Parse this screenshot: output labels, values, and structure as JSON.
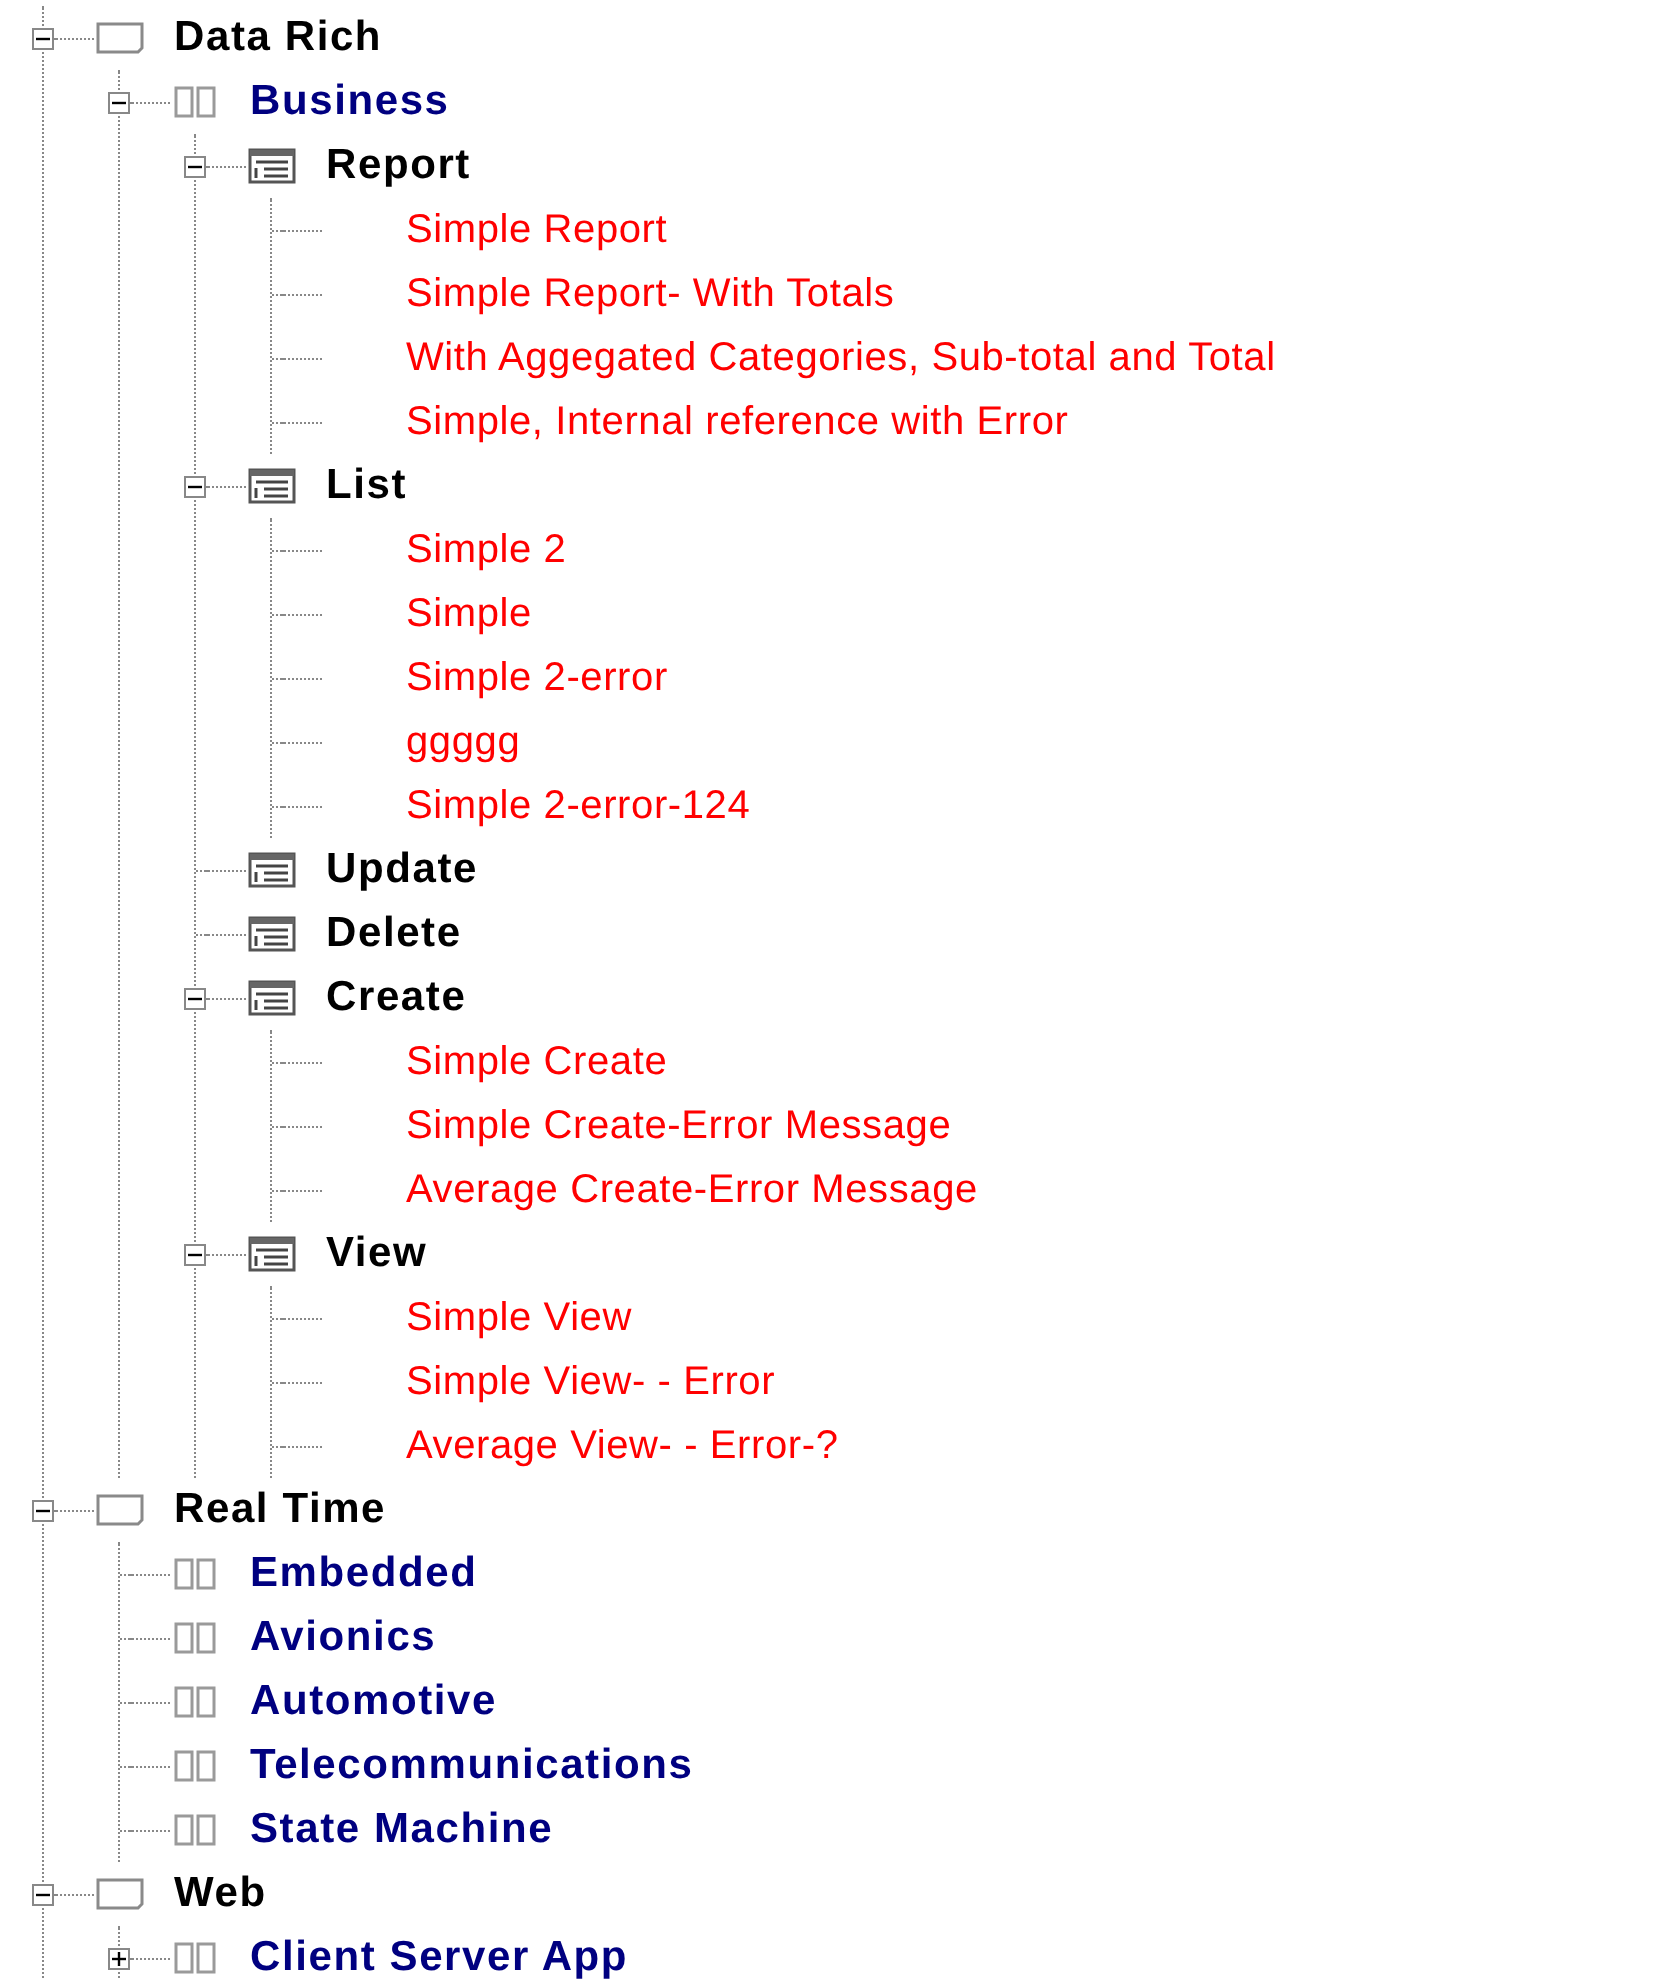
{
  "tree": {
    "nodes": [
      {
        "label": "Data Rich",
        "kind": "group",
        "expanded": true,
        "children": [
          {
            "label": "Business",
            "kind": "category",
            "expanded": true,
            "children": [
              {
                "label": "Report",
                "kind": "section",
                "expanded": true,
                "children": [
                  {
                    "label": "Simple Report",
                    "kind": "item"
                  },
                  {
                    "label": "Simple Report- With Totals",
                    "kind": "item"
                  },
                  {
                    "label": "With Aggegated Categories, Sub-total and Total",
                    "kind": "item"
                  },
                  {
                    "label": "Simple, Internal reference with Error",
                    "kind": "item"
                  }
                ]
              },
              {
                "label": "List",
                "kind": "section",
                "expanded": true,
                "children": [
                  {
                    "label": "Simple 2",
                    "kind": "item"
                  },
                  {
                    "label": "Simple",
                    "kind": "item"
                  },
                  {
                    "label": "Simple 2-error",
                    "kind": "item"
                  },
                  {
                    "label": "ggggg",
                    "kind": "item"
                  },
                  {
                    "label": "Simple 2-error-124",
                    "kind": "item"
                  }
                ]
              },
              {
                "label": "Update",
                "kind": "section"
              },
              {
                "label": "Delete",
                "kind": "section"
              },
              {
                "label": "Create",
                "kind": "section",
                "expanded": true,
                "children": [
                  {
                    "label": "Simple Create",
                    "kind": "item"
                  },
                  {
                    "label": "Simple Create-Error Message",
                    "kind": "item"
                  },
                  {
                    "label": "Average  Create-Error Message",
                    "kind": "item"
                  }
                ]
              },
              {
                "label": "View",
                "kind": "section",
                "expanded": true,
                "children": [
                  {
                    "label": "Simple View",
                    "kind": "item"
                  },
                  {
                    "label": "Simple View- - Error",
                    "kind": "item"
                  },
                  {
                    "label": "Average View- - Error-?",
                    "kind": "item"
                  }
                ]
              }
            ]
          }
        ]
      },
      {
        "label": "Real Time",
        "kind": "group",
        "expanded": true,
        "children": [
          {
            "label": "Embedded",
            "kind": "category"
          },
          {
            "label": "Avionics",
            "kind": "category"
          },
          {
            "label": "Automotive",
            "kind": "category"
          },
          {
            "label": "Telecommunications",
            "kind": "category"
          },
          {
            "label": "State Machine",
            "kind": "category"
          }
        ]
      },
      {
        "label": "Web",
        "kind": "group",
        "expanded": true,
        "children": [
          {
            "label": "Client Server App",
            "kind": "category",
            "expanded": false
          }
        ]
      }
    ]
  }
}
